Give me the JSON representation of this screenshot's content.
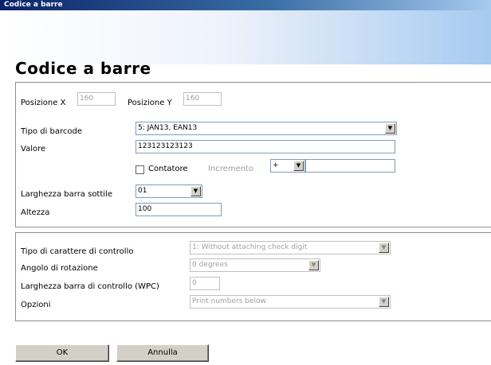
{
  "window": {
    "title": "Codice a barre"
  },
  "page": {
    "heading": "Codice a barre"
  },
  "position": {
    "x_label": "Posizione X",
    "x_value": "160",
    "y_label": "Posizione Y",
    "y_value": "160"
  },
  "barcode": {
    "type_label": "Tipo di barcode",
    "type_value": "5: JAN13, EAN13",
    "value_label": "Valore",
    "value": "123123123123",
    "counter_label": "Contatore",
    "counter_checked": false,
    "increment_label": "Incremento",
    "increment_sign": "+",
    "increment_value": "",
    "narrow_label": "Larghezza barra sottile",
    "narrow_value": "01",
    "height_label": "Altezza",
    "height_value": "100"
  },
  "check": {
    "char_label": "Tipo di carattere di controllo",
    "char_value": "1: Without attaching check digit",
    "rotation_label": "Angolo di rotazione",
    "rotation_value": "0  degrees",
    "wpc_label": "Larghezza barra di controllo (WPC)",
    "wpc_value": "0",
    "options_label": "Opzioni",
    "options_value": "Print numbers below"
  },
  "buttons": {
    "ok": "OK",
    "cancel": "Annulla"
  },
  "icons": {
    "dropdown": "chevron-down-icon",
    "checkbox": "checkbox-unchecked"
  },
  "colors": {
    "title_bar": "#0a246a",
    "button_face": "#d4d0c8",
    "field_border": "#7f9db9",
    "disabled_text": "#a0a0a0"
  }
}
